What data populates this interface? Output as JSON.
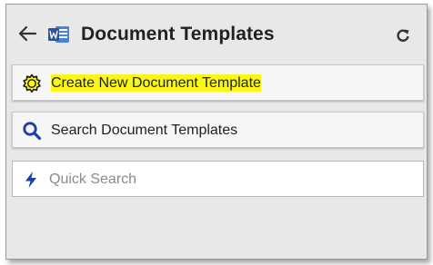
{
  "header": {
    "title": "Document Templates",
    "back_icon": "arrow-left-icon",
    "app_icon": "word-icon",
    "refresh_icon": "refresh-icon"
  },
  "actions": {
    "create_label": "Create New Document Template",
    "create_icon": "gear-icon",
    "search_label": "Search Document Templates",
    "search_icon": "search-icon"
  },
  "quick_search": {
    "placeholder": "Quick Search",
    "value": "",
    "icon": "lightning-icon"
  },
  "colors": {
    "highlight": "#fbf715",
    "accent_blue": "#1a3faa",
    "word_blue": "#2b579a"
  }
}
